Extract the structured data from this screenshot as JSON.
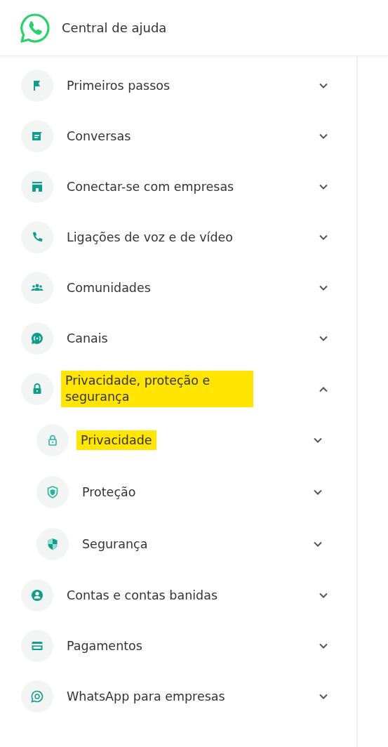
{
  "header": {
    "title": "Central de ajuda"
  },
  "sidebar": {
    "items": [
      {
        "label": "Primeiros passos",
        "expanded": false,
        "highlighted": false
      },
      {
        "label": "Conversas",
        "expanded": false,
        "highlighted": false
      },
      {
        "label": "Conectar-se com empresas",
        "expanded": false,
        "highlighted": false
      },
      {
        "label": "Ligações de voz e de vídeo",
        "expanded": false,
        "highlighted": false
      },
      {
        "label": "Comunidades",
        "expanded": false,
        "highlighted": false
      },
      {
        "label": "Canais",
        "expanded": false,
        "highlighted": false
      },
      {
        "label": "Privacidade, proteção e segurança",
        "expanded": true,
        "highlighted": true,
        "children": [
          {
            "label": "Privacidade",
            "expanded": false,
            "highlighted": true
          },
          {
            "label": "Proteção",
            "expanded": false,
            "highlighted": false
          },
          {
            "label": "Segurança",
            "expanded": false,
            "highlighted": false
          }
        ]
      },
      {
        "label": "Contas e contas banidas",
        "expanded": false,
        "highlighted": false
      },
      {
        "label": "Pagamentos",
        "expanded": false,
        "highlighted": false
      },
      {
        "label": "WhatsApp para empresas",
        "expanded": false,
        "highlighted": false
      }
    ]
  }
}
